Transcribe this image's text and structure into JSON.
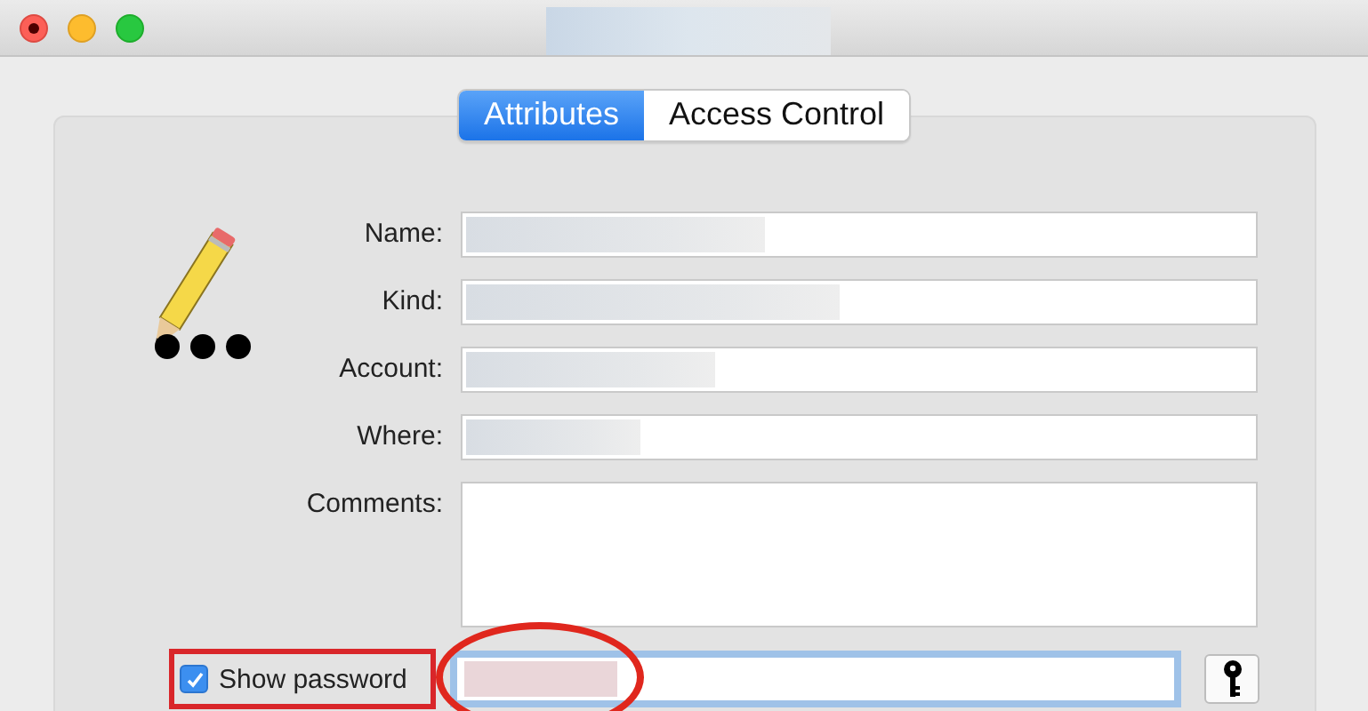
{
  "window": {
    "title_redacted": true
  },
  "tabs": [
    {
      "label": "Attributes",
      "selected": true
    },
    {
      "label": "Access Control",
      "selected": false
    }
  ],
  "fields": [
    {
      "label": "Name:",
      "kind": "line",
      "redacted": true
    },
    {
      "label": "Kind:",
      "kind": "line",
      "redacted": true
    },
    {
      "label": "Account:",
      "kind": "line",
      "redacted": true
    },
    {
      "label": "Where:",
      "kind": "line",
      "redacted": true
    },
    {
      "label": "Comments:",
      "kind": "multiline",
      "redacted": false
    }
  ],
  "show_password": {
    "label": "Show password",
    "checked": true
  },
  "password": {
    "focused": true,
    "redacted": true
  }
}
